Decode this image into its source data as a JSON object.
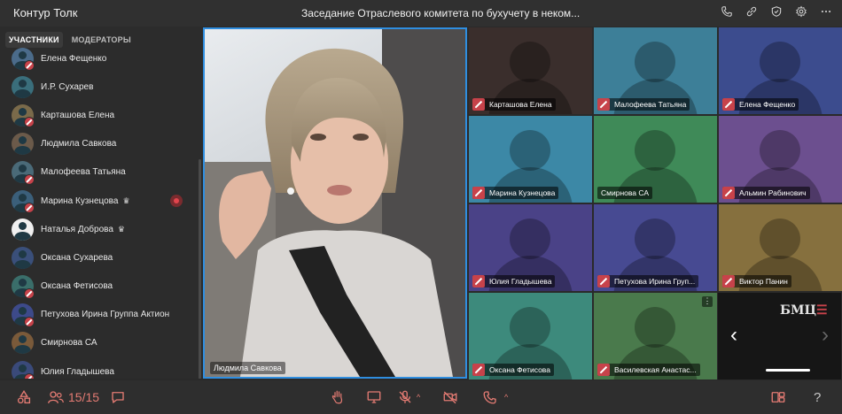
{
  "app": {
    "title": "Контур Толк"
  },
  "meeting": {
    "title": "Заседание Отраслевого комитета по бухучету в неком..."
  },
  "sidebar": {
    "tabs": [
      {
        "label": "УЧАСТНИКИ",
        "active": true
      },
      {
        "label": "МОДЕРАТОРЫ",
        "active": false
      }
    ],
    "participants": [
      {
        "name": "Елена Фещенко",
        "muted": true
      },
      {
        "name": "И.Р. Сухарев",
        "muted": false
      },
      {
        "name": "Карташова Елена",
        "muted": true
      },
      {
        "name": "Людмила Савкова",
        "muted": false
      },
      {
        "name": "Малофеева Татьяна",
        "muted": true
      },
      {
        "name": "Марина Кузнецова",
        "muted": true,
        "crown": true,
        "recording": true
      },
      {
        "name": "Наталья Доброва",
        "muted": false,
        "crown": true
      },
      {
        "name": "Оксана Сухарева",
        "muted": false
      },
      {
        "name": "Оксана Фетисова",
        "muted": true
      },
      {
        "name": "Петухова Ирина Группа Актион",
        "muted": true
      },
      {
        "name": "Смирнова СА",
        "muted": false
      },
      {
        "name": "Юлия Гладышева",
        "muted": true
      }
    ]
  },
  "speaker": {
    "name": "Людмила Савкова"
  },
  "grid": {
    "tiles": [
      {
        "name": "Карташова Елена",
        "muted": true,
        "bg": "#3a2e2c"
      },
      {
        "name": "Малофеева Татьяна",
        "muted": true,
        "bg": "#3d7f98"
      },
      {
        "name": "Елена Фещенко",
        "muted": true,
        "bg": "#3c4c8e"
      },
      {
        "name": "Марина Кузнецова",
        "muted": true,
        "bg": "#3c88a6"
      },
      {
        "name": "Смирнова СА",
        "muted": false,
        "bg": "#3f8a58"
      },
      {
        "name": "Альмин Рабинович",
        "muted": true,
        "bg": "#6c4f8f"
      },
      {
        "name": "Юлия Гладышева",
        "muted": true,
        "bg": "#4a4287"
      },
      {
        "name": "Петухова Ирина Груп...",
        "muted": true,
        "bg": "#474a92"
      },
      {
        "name": "Виктор Панин",
        "muted": true,
        "bg": "#86703e"
      },
      {
        "name": "Оксана Фетисова",
        "muted": true,
        "bg": "#3d8a7c"
      },
      {
        "name": "Василевская Анастас...",
        "muted": true,
        "bg": "#4a7a4c"
      }
    ],
    "logo_tile": {
      "text": "БМЦ"
    }
  },
  "bottombar": {
    "participants_count": "15/15",
    "help": "?"
  },
  "colors": {
    "accent": "#2f8ee0",
    "mute": "#c7424a",
    "count": "#e47b73"
  }
}
